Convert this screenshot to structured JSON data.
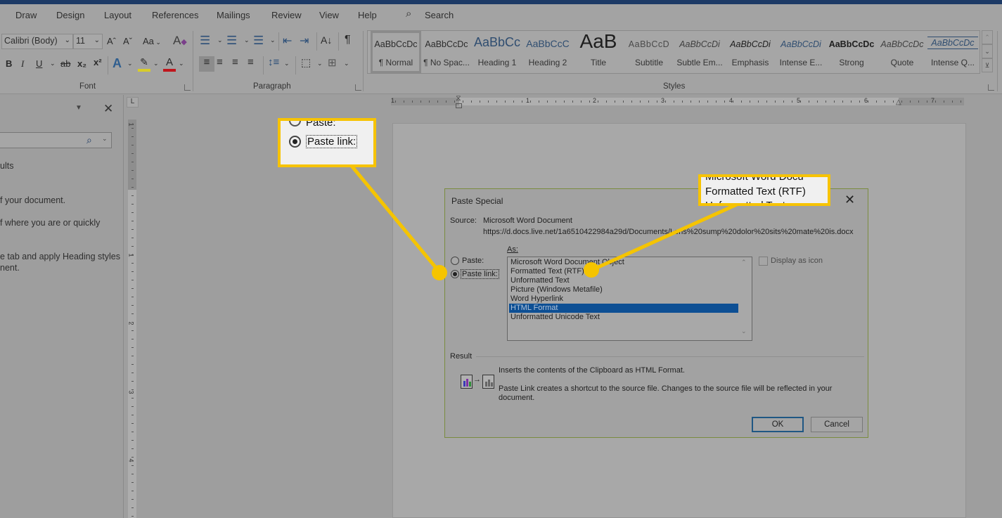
{
  "ribbon": {
    "tabs": [
      "Draw",
      "Design",
      "Layout",
      "References",
      "Mailings",
      "Review",
      "View",
      "Help"
    ],
    "search_label": "Search",
    "font": {
      "font_name": "Calibri (Body)",
      "font_size": "11",
      "group_label": "Font",
      "grow": "Aˆ",
      "shrink": "Aˇ",
      "case": "Aa",
      "bold": "B",
      "italic": "I",
      "underline": "U",
      "strike": "ab",
      "subscript": "x₂",
      "superscript": "x²",
      "text_effects": "A",
      "font_color": "A",
      "highlight_color": "#d8cc2a",
      "font_color_value": "#c0161c"
    },
    "paragraph": {
      "group_label": "Paragraph",
      "pilcrow": "¶",
      "sort": "A↓"
    },
    "styles": {
      "group_label": "Styles",
      "items": [
        {
          "preview": "AaBbCcDc",
          "label": "¶ Normal"
        },
        {
          "preview": "AaBbCcDc",
          "label": "¶ No Spac..."
        },
        {
          "preview": "AaBbCc",
          "label": "Heading 1"
        },
        {
          "preview": "AaBbCcC",
          "label": "Heading 2"
        },
        {
          "preview": "AaB",
          "label": "Title"
        },
        {
          "preview": "AaBbCcD",
          "label": "Subtitle"
        },
        {
          "preview": "AaBbCcDi",
          "label": "Subtle Em..."
        },
        {
          "preview": "AaBbCcDi",
          "label": "Emphasis"
        },
        {
          "preview": "AaBbCcDi",
          "label": "Intense E..."
        },
        {
          "preview": "AaBbCcDc",
          "label": "Strong"
        },
        {
          "preview": "AaBbCcDc",
          "label": "Quote"
        },
        {
          "preview": "AaBbCcDc",
          "label": "Intense Q..."
        }
      ]
    }
  },
  "nav_pane": {
    "lines": [
      "ults",
      "f your document.",
      "f where you are or quickly",
      "e tab and apply Heading styles",
      "nent."
    ]
  },
  "rulers": {
    "horizontal_numbers": [
      "1",
      "1",
      "2",
      "3",
      "4",
      "5",
      "6",
      "7"
    ],
    "vertical_numbers": [
      "1",
      "1",
      "2",
      "3",
      "4"
    ],
    "tab_selector": "L"
  },
  "dialog": {
    "title": "Paste Special",
    "source_label": "Source:",
    "source_name": "Microsoft Word Document",
    "source_path": "https://d.docs.live.net/1a6510422984a29d/Documents/Loris%20sump%20dolor%20sits%20mate%20is.docx",
    "as_label": "As:",
    "paste_label": "Paste:",
    "paste_link_label": "Paste link:",
    "selected_mode": "Paste link",
    "as_options": [
      "Microsoft Word Document Object",
      "Formatted Text (RTF)",
      "Unformatted Text",
      "Picture (Windows Metafile)",
      "Word Hyperlink",
      "HTML Format",
      "Unformatted Unicode Text"
    ],
    "selected_option": "HTML Format",
    "display_as_icon": "Display as icon",
    "display_as_icon_checked": false,
    "result_label": "Result",
    "result_line1": "Inserts the contents of the Clipboard as HTML Format.",
    "result_line2": "Paste Link creates a shortcut to the source file. Changes to the source file will be reflected in your",
    "result_line3": "document.",
    "ok_label": "OK",
    "cancel_label": "Cancel"
  },
  "callouts": {
    "left": {
      "top_text": "Paste:",
      "main_text": "Paste link:"
    },
    "right": {
      "top_text": "Microsoft Word Docu",
      "main_text": "Formatted Text (RTF)",
      "bottom_text": "Unformatted Text"
    },
    "highlight_color": "#f7c300"
  }
}
